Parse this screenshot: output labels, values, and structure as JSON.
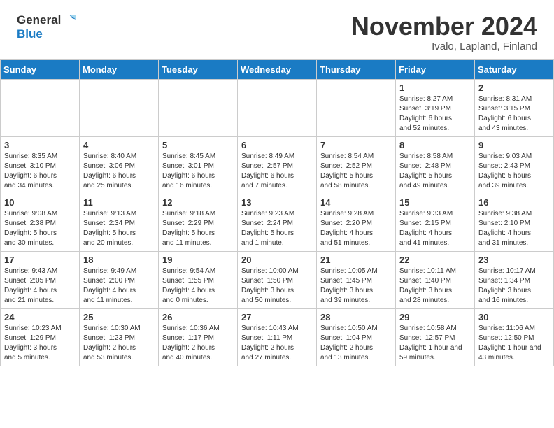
{
  "header": {
    "logo_general": "General",
    "logo_blue": "Blue",
    "month": "November 2024",
    "location": "Ivalo, Lapland, Finland"
  },
  "weekdays": [
    "Sunday",
    "Monday",
    "Tuesday",
    "Wednesday",
    "Thursday",
    "Friday",
    "Saturday"
  ],
  "weeks": [
    [
      {
        "day": "",
        "info": ""
      },
      {
        "day": "",
        "info": ""
      },
      {
        "day": "",
        "info": ""
      },
      {
        "day": "",
        "info": ""
      },
      {
        "day": "",
        "info": ""
      },
      {
        "day": "1",
        "info": "Sunrise: 8:27 AM\nSunset: 3:19 PM\nDaylight: 6 hours\nand 52 minutes."
      },
      {
        "day": "2",
        "info": "Sunrise: 8:31 AM\nSunset: 3:15 PM\nDaylight: 6 hours\nand 43 minutes."
      }
    ],
    [
      {
        "day": "3",
        "info": "Sunrise: 8:35 AM\nSunset: 3:10 PM\nDaylight: 6 hours\nand 34 minutes."
      },
      {
        "day": "4",
        "info": "Sunrise: 8:40 AM\nSunset: 3:06 PM\nDaylight: 6 hours\nand 25 minutes."
      },
      {
        "day": "5",
        "info": "Sunrise: 8:45 AM\nSunset: 3:01 PM\nDaylight: 6 hours\nand 16 minutes."
      },
      {
        "day": "6",
        "info": "Sunrise: 8:49 AM\nSunset: 2:57 PM\nDaylight: 6 hours\nand 7 minutes."
      },
      {
        "day": "7",
        "info": "Sunrise: 8:54 AM\nSunset: 2:52 PM\nDaylight: 5 hours\nand 58 minutes."
      },
      {
        "day": "8",
        "info": "Sunrise: 8:58 AM\nSunset: 2:48 PM\nDaylight: 5 hours\nand 49 minutes."
      },
      {
        "day": "9",
        "info": "Sunrise: 9:03 AM\nSunset: 2:43 PM\nDaylight: 5 hours\nand 39 minutes."
      }
    ],
    [
      {
        "day": "10",
        "info": "Sunrise: 9:08 AM\nSunset: 2:38 PM\nDaylight: 5 hours\nand 30 minutes."
      },
      {
        "day": "11",
        "info": "Sunrise: 9:13 AM\nSunset: 2:34 PM\nDaylight: 5 hours\nand 20 minutes."
      },
      {
        "day": "12",
        "info": "Sunrise: 9:18 AM\nSunset: 2:29 PM\nDaylight: 5 hours\nand 11 minutes."
      },
      {
        "day": "13",
        "info": "Sunrise: 9:23 AM\nSunset: 2:24 PM\nDaylight: 5 hours\nand 1 minute."
      },
      {
        "day": "14",
        "info": "Sunrise: 9:28 AM\nSunset: 2:20 PM\nDaylight: 4 hours\nand 51 minutes."
      },
      {
        "day": "15",
        "info": "Sunrise: 9:33 AM\nSunset: 2:15 PM\nDaylight: 4 hours\nand 41 minutes."
      },
      {
        "day": "16",
        "info": "Sunrise: 9:38 AM\nSunset: 2:10 PM\nDaylight: 4 hours\nand 31 minutes."
      }
    ],
    [
      {
        "day": "17",
        "info": "Sunrise: 9:43 AM\nSunset: 2:05 PM\nDaylight: 4 hours\nand 21 minutes."
      },
      {
        "day": "18",
        "info": "Sunrise: 9:49 AM\nSunset: 2:00 PM\nDaylight: 4 hours\nand 11 minutes."
      },
      {
        "day": "19",
        "info": "Sunrise: 9:54 AM\nSunset: 1:55 PM\nDaylight: 4 hours\nand 0 minutes."
      },
      {
        "day": "20",
        "info": "Sunrise: 10:00 AM\nSunset: 1:50 PM\nDaylight: 3 hours\nand 50 minutes."
      },
      {
        "day": "21",
        "info": "Sunrise: 10:05 AM\nSunset: 1:45 PM\nDaylight: 3 hours\nand 39 minutes."
      },
      {
        "day": "22",
        "info": "Sunrise: 10:11 AM\nSunset: 1:40 PM\nDaylight: 3 hours\nand 28 minutes."
      },
      {
        "day": "23",
        "info": "Sunrise: 10:17 AM\nSunset: 1:34 PM\nDaylight: 3 hours\nand 16 minutes."
      }
    ],
    [
      {
        "day": "24",
        "info": "Sunrise: 10:23 AM\nSunset: 1:29 PM\nDaylight: 3 hours\nand 5 minutes."
      },
      {
        "day": "25",
        "info": "Sunrise: 10:30 AM\nSunset: 1:23 PM\nDaylight: 2 hours\nand 53 minutes."
      },
      {
        "day": "26",
        "info": "Sunrise: 10:36 AM\nSunset: 1:17 PM\nDaylight: 2 hours\nand 40 minutes."
      },
      {
        "day": "27",
        "info": "Sunrise: 10:43 AM\nSunset: 1:11 PM\nDaylight: 2 hours\nand 27 minutes."
      },
      {
        "day": "28",
        "info": "Sunrise: 10:50 AM\nSunset: 1:04 PM\nDaylight: 2 hours\nand 13 minutes."
      },
      {
        "day": "29",
        "info": "Sunrise: 10:58 AM\nSunset: 12:57 PM\nDaylight: 1 hour and\n59 minutes."
      },
      {
        "day": "30",
        "info": "Sunrise: 11:06 AM\nSunset: 12:50 PM\nDaylight: 1 hour and\n43 minutes."
      }
    ]
  ]
}
